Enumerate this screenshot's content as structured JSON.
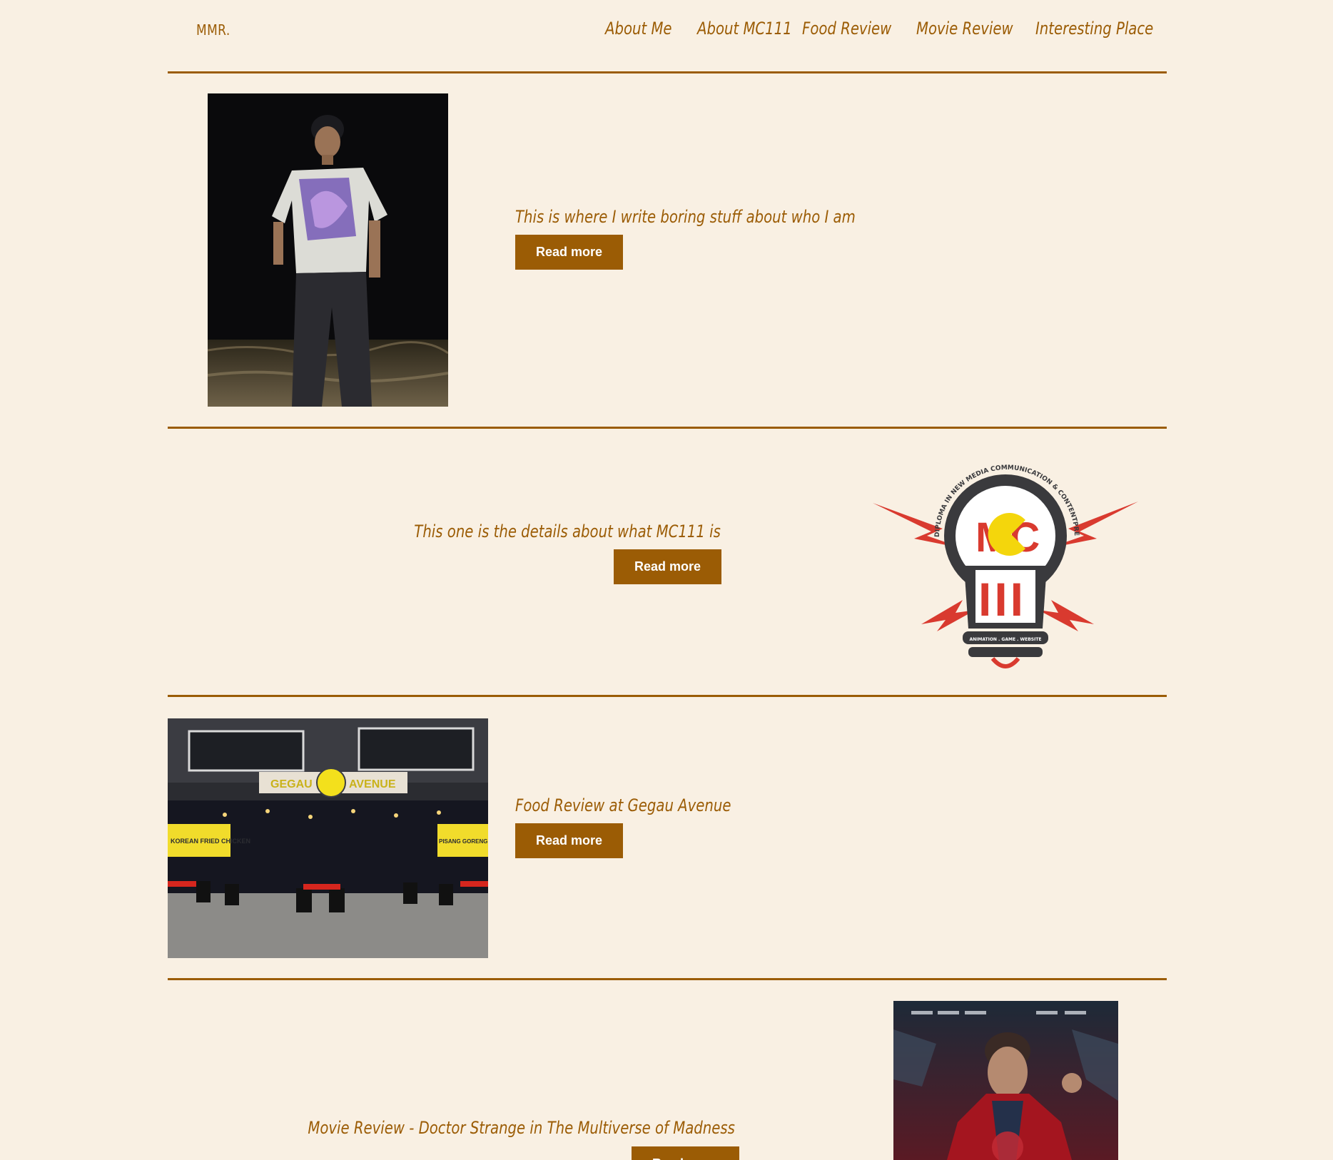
{
  "header": {
    "logo": "MMR.",
    "nav": [
      "About Me",
      "About MC111",
      "Food Review",
      "Movie Review",
      "Interesting Place"
    ]
  },
  "sections": [
    {
      "text": "This is where I write boring stuff about who I am",
      "button": "Read more"
    },
    {
      "text": "This one is the details about what MC111 is",
      "button": "Read more"
    },
    {
      "text": "Food Review at Gegau Avenue",
      "button": "Read more"
    },
    {
      "text": "Movie Review - Doctor Strange in The Multiverse of Madness",
      "button": "Read more"
    }
  ],
  "mc111_logo": {
    "arc_text": "DIPLOMA IN NEW MEDIA COMMUNICATION & CONTENTPRENEURSHIP",
    "mark": "MC",
    "numeral": "III",
    "tag": "ANIMATION . GAME . WEBSITE"
  },
  "gegau_sign": {
    "left": "GEGAU",
    "right": "AVENUE",
    "banner_left": "KOREAN FRIED CHICKEN",
    "banner_right": "PISANG GORENG"
  },
  "colors": {
    "background": "#f9f0e3",
    "brand": "#9b5c05",
    "button_text": "#ffffff"
  }
}
